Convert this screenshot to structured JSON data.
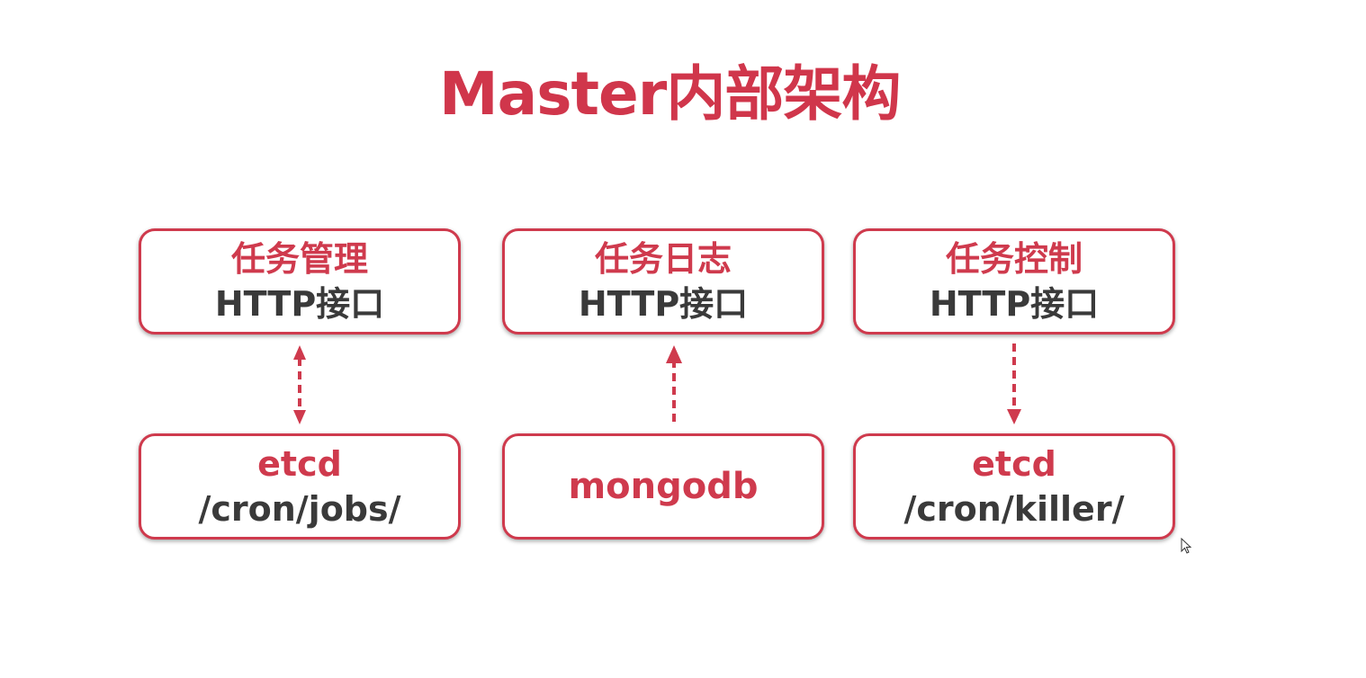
{
  "slide": {
    "title": "Master内部架构",
    "columns": [
      {
        "top": {
          "title": "任务管理",
          "subtitle": "HTTP接口"
        },
        "bottom": {
          "title": "etcd",
          "subtitle": "/cron/jobs/"
        },
        "arrow": "bidirectional"
      },
      {
        "top": {
          "title": "任务日志",
          "subtitle": "HTTP接口"
        },
        "bottom": {
          "title": "mongodb"
        },
        "arrow": "up"
      },
      {
        "top": {
          "title": "任务控制",
          "subtitle": "HTTP接口"
        },
        "bottom": {
          "title": "etcd",
          "subtitle": "/cron/killer/"
        },
        "arrow": "down"
      }
    ]
  },
  "colors": {
    "accent": "#cf3a4d",
    "text_dark": "#3a3a3a",
    "background": "#ffffff"
  },
  "icons": {
    "cursor": "mouse-pointer-icon"
  }
}
